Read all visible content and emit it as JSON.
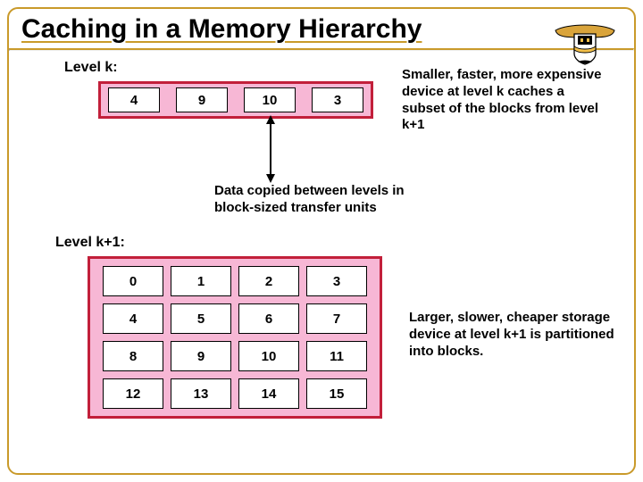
{
  "title": "Caching in a Memory Hierarchy",
  "labels": {
    "level_k": "Level k:",
    "level_k1": "Level k+1:"
  },
  "level_k_blocks": [
    "4",
    "9",
    "10",
    "3"
  ],
  "level_k1_blocks": [
    "0",
    "1",
    "2",
    "3",
    "4",
    "5",
    "6",
    "7",
    "8",
    "9",
    "10",
    "11",
    "12",
    "13",
    "14",
    "15"
  ],
  "annotations": {
    "k_desc": "Smaller, faster, more expensive device at level k caches a subset of the blocks from level k+1",
    "transfer": "Data copied between levels in block-sized transfer units",
    "k1_desc": "Larger, slower, cheaper storage device at level k+1 is partitioned into blocks."
  }
}
